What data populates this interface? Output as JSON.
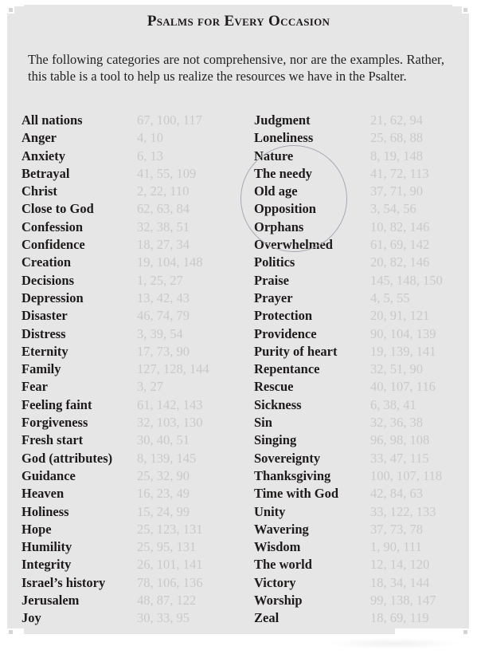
{
  "document": {
    "title": "Psalms for Every Occasion",
    "intro": "The following categories are not comprehensive, nor are the examples. Rather, this table is a tool to help us realize the resources we have in the Psalter."
  },
  "table": {
    "left": [
      {
        "category": "All nations",
        "psalms": "67, 100, 117"
      },
      {
        "category": "Anger",
        "psalms": "4, 10"
      },
      {
        "category": "Anxiety",
        "psalms": "6, 13"
      },
      {
        "category": "Betrayal",
        "psalms": "41, 55, 109"
      },
      {
        "category": "Christ",
        "psalms": "2, 22, 110"
      },
      {
        "category": "Close to God",
        "psalms": "62, 63, 84"
      },
      {
        "category": "Confession",
        "psalms": "32, 38, 51"
      },
      {
        "category": "Confidence",
        "psalms": "18, 27, 34"
      },
      {
        "category": "Creation",
        "psalms": "19, 104, 148"
      },
      {
        "category": "Decisions",
        "psalms": "1, 25, 27"
      },
      {
        "category": "Depression",
        "psalms": "13, 42, 43"
      },
      {
        "category": "Disaster",
        "psalms": "46, 74, 79"
      },
      {
        "category": "Distress",
        "psalms": "3, 39, 54"
      },
      {
        "category": "Eternity",
        "psalms": "17, 73, 90"
      },
      {
        "category": "Family",
        "psalms": "127, 128, 144"
      },
      {
        "category": "Fear",
        "psalms": "3, 27"
      },
      {
        "category": "Feeling faint",
        "psalms": "61, 142, 143"
      },
      {
        "category": "Forgiveness",
        "psalms": "32, 103, 130"
      },
      {
        "category": "Fresh start",
        "psalms": "30, 40, 51"
      },
      {
        "category": "God (attributes)",
        "psalms": "8, 139, 145"
      },
      {
        "category": "Guidance",
        "psalms": "25, 32, 90"
      },
      {
        "category": "Heaven",
        "psalms": "16, 23, 49"
      },
      {
        "category": "Holiness",
        "psalms": "15, 24, 99"
      },
      {
        "category": "Hope",
        "psalms": "25, 123, 131"
      },
      {
        "category": "Humility",
        "psalms": "25, 95, 131"
      },
      {
        "category": "Integrity",
        "psalms": "26, 101, 141"
      },
      {
        "category": "Israel’s history",
        "psalms": "78, 106, 136"
      },
      {
        "category": "Jerusalem",
        "psalms": "48, 87, 122"
      },
      {
        "category": "Joy",
        "psalms": "30, 33, 95"
      }
    ],
    "right": [
      {
        "category": "Judgment",
        "psalms": "21, 62, 94"
      },
      {
        "category": "Loneliness",
        "psalms": "25, 68, 88"
      },
      {
        "category": "Nature",
        "psalms": "8, 19, 148"
      },
      {
        "category": "The needy",
        "psalms": "41, 72, 113"
      },
      {
        "category": "Old age",
        "psalms": "37, 71, 90"
      },
      {
        "category": "Opposition",
        "psalms": "3, 54, 56"
      },
      {
        "category": "Orphans",
        "psalms": "10, 82, 146"
      },
      {
        "category": "Overwhelmed",
        "psalms": "61, 69, 142"
      },
      {
        "category": "Politics",
        "psalms": "20, 82, 146"
      },
      {
        "category": "Praise",
        "psalms": "145, 148, 150"
      },
      {
        "category": "Prayer",
        "psalms": "4, 5, 55"
      },
      {
        "category": "Protection",
        "psalms": "20, 91, 121"
      },
      {
        "category": "Providence",
        "psalms": "90, 104, 139"
      },
      {
        "category": "Purity of heart",
        "psalms": "19, 139, 141"
      },
      {
        "category": "Repentance",
        "psalms": "32, 51, 90"
      },
      {
        "category": "Rescue",
        "psalms": "40, 107, 116"
      },
      {
        "category": "Sickness",
        "psalms": "6, 38, 41"
      },
      {
        "category": "Sin",
        "psalms": "32, 36, 38"
      },
      {
        "category": "Singing",
        "psalms": "96, 98, 108"
      },
      {
        "category": "Sovereignty",
        "psalms": "33, 47, 115"
      },
      {
        "category": "Thanksgiving",
        "psalms": "100, 107, 118"
      },
      {
        "category": "Time with God",
        "psalms": "42, 84, 63"
      },
      {
        "category": "Unity",
        "psalms": "33, 122, 133"
      },
      {
        "category": "Wavering",
        "psalms": "37, 73, 78"
      },
      {
        "category": "Wisdom",
        "psalms": "1, 90, 111"
      },
      {
        "category": "The world",
        "psalms": "12, 14, 120"
      },
      {
        "category": "Victory",
        "psalms": "18, 34, 144"
      },
      {
        "category": "Worship",
        "psalms": "99, 138, 147"
      },
      {
        "category": "Zeal",
        "psalms": "18, 69, 119"
      }
    ]
  }
}
